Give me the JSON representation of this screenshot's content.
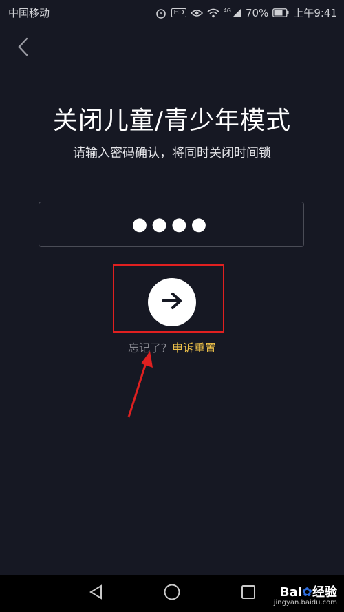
{
  "status_bar": {
    "carrier": "中国移动",
    "hd_badge": "HD",
    "network": "4G",
    "battery": "70%",
    "time": "上午9:41"
  },
  "header": {
    "title": "关闭儿童/青少年模式",
    "subtitle": "请输入密码确认，将同时关闭时间锁"
  },
  "password": {
    "masked_value": "●●●●"
  },
  "forgot": {
    "question": "忘记了？",
    "link": "申诉重置"
  },
  "watermark": {
    "brand_left": "Bai",
    "brand_paw": "✿",
    "brand_right": "经验",
    "site": "jingyan.baidu.com"
  },
  "colors": {
    "background": "#161823",
    "accent": "#f0c34a",
    "highlight": "#e02020"
  }
}
